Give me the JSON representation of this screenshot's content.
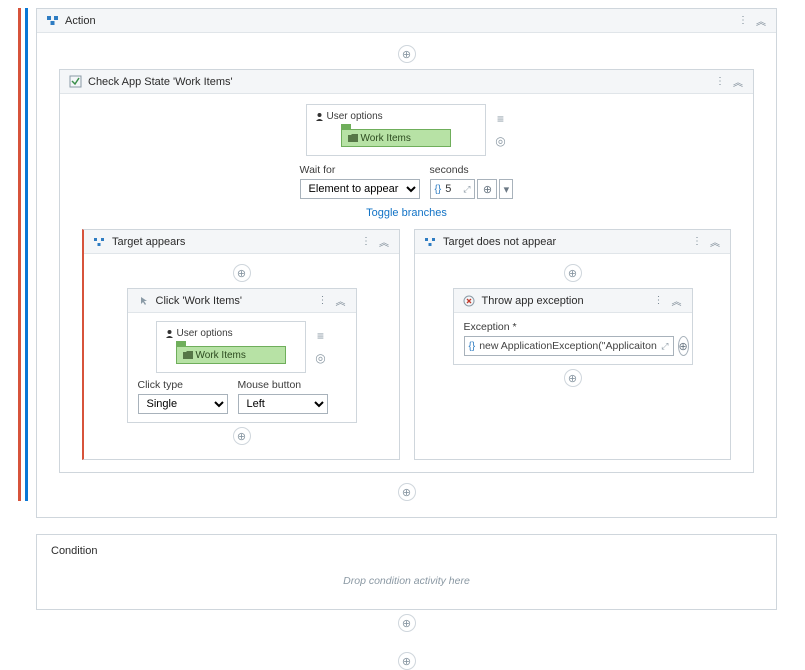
{
  "action": {
    "title": "Action"
  },
  "checkAppState": {
    "title": "Check App State 'Work Items'",
    "userOptions": "User options",
    "workItems": "Work Items",
    "waitForLabel": "Wait for",
    "waitForValue": "Element to appear",
    "secondsLabel": "seconds",
    "secondsValue": "5",
    "toggleBranches": "Toggle branches"
  },
  "targetAppears": {
    "title": "Target appears"
  },
  "clickWorkItems": {
    "title": "Click 'Work Items'",
    "userOptions": "User options",
    "workItems": "Work Items",
    "clickTypeLabel": "Click type",
    "clickTypeValue": "Single",
    "mouseButtonLabel": "Mouse button",
    "mouseButtonValue": "Left"
  },
  "targetDoesNotAppear": {
    "title": "Target does not appear"
  },
  "throwException": {
    "title": "Throw app exception",
    "exceptionLabel": "Exception",
    "exceptionValue": "new ApplicationException(\"Applicaiton n…"
  },
  "condition": {
    "title": "Condition",
    "hint": "Drop condition activity here"
  }
}
